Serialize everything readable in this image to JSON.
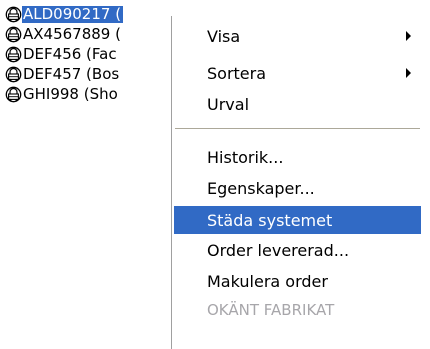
{
  "list": {
    "icon": "padlock-car-icon",
    "partial_top_label": "",
    "items": [
      {
        "label": "ALD090217 (",
        "selected": true
      },
      {
        "label": "AX4567889 (",
        "selected": false
      },
      {
        "label": "DEF456 (Fac",
        "selected": false
      },
      {
        "label": "DEF457 (Bos",
        "selected": false
      },
      {
        "label": "GHI998 (Sho",
        "selected": false
      }
    ]
  },
  "context_menu": {
    "items": [
      {
        "label": "Visa",
        "has_submenu": true,
        "state": "normal"
      },
      {
        "label": "Sortera",
        "has_submenu": true,
        "state": "normal"
      },
      {
        "label": "Urval",
        "has_submenu": false,
        "state": "normal"
      },
      {
        "separator": true
      },
      {
        "label": "Historik...",
        "has_submenu": false,
        "state": "normal"
      },
      {
        "label": "Egenskaper...",
        "has_submenu": false,
        "state": "normal"
      },
      {
        "label": "Städa systemet",
        "has_submenu": false,
        "state": "highlighted"
      },
      {
        "label": "Order levererad...",
        "has_submenu": false,
        "state": "normal"
      },
      {
        "label": "Makulera order",
        "has_submenu": false,
        "state": "normal"
      },
      {
        "label": "OKÄNT FABRIKAT",
        "has_submenu": false,
        "state": "disabled"
      }
    ]
  },
  "colors": {
    "selection": "#316ac5",
    "selection_text": "#ffffff",
    "disabled_text": "#a7a6aa",
    "separator": "#aca899"
  }
}
